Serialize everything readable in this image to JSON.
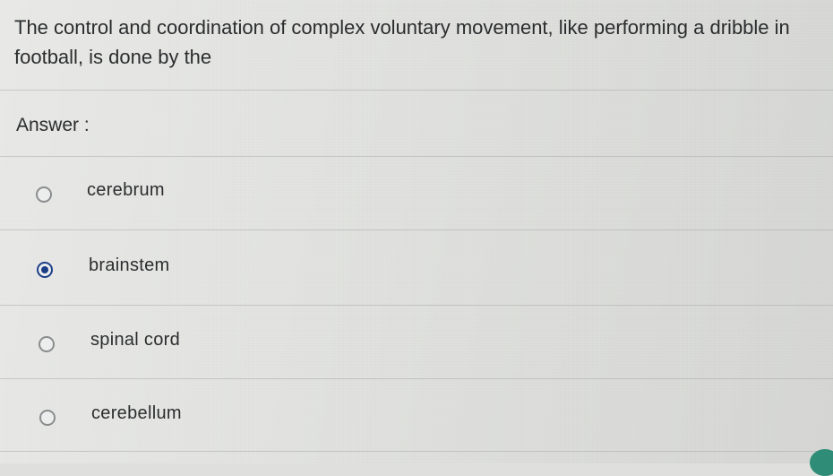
{
  "question": {
    "text": "The control and coordination of complex voluntary movement, like performing a dribble in football, is done by the"
  },
  "answer_label": "Answer :",
  "options": [
    {
      "label": "cerebrum",
      "selected": false
    },
    {
      "label": "brainstem",
      "selected": true
    },
    {
      "label": "spinal cord",
      "selected": false
    },
    {
      "label": "cerebellum",
      "selected": false
    }
  ],
  "colors": {
    "selected_radio": "#1b3c86",
    "unselected_radio_border": "#8a8c8e",
    "background": "#dfe0dd"
  }
}
